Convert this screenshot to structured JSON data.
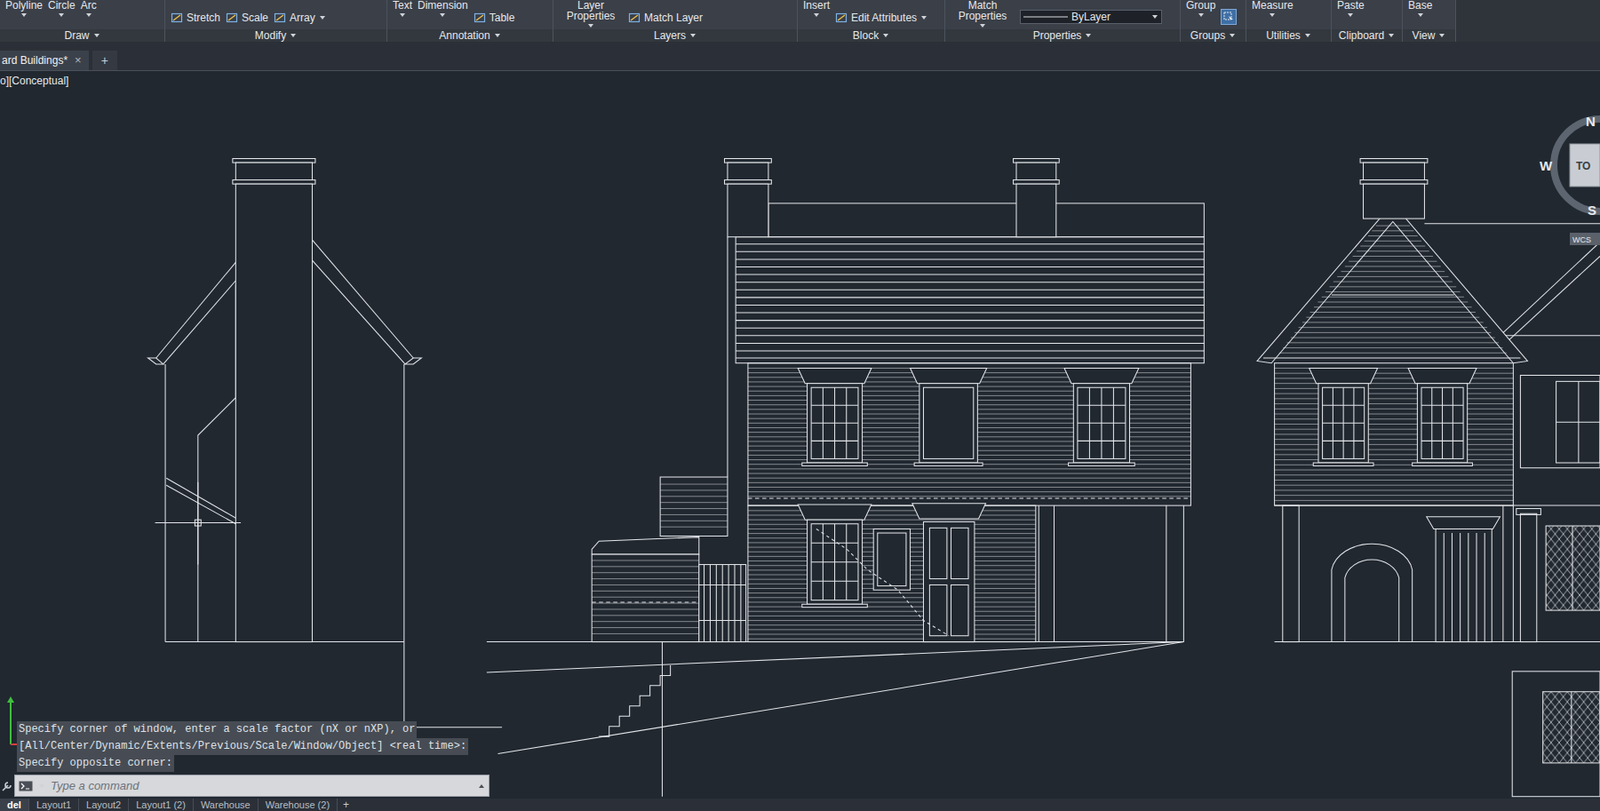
{
  "ribbon": {
    "panels": [
      {
        "label": "Draw",
        "items": [
          {
            "kind": "large",
            "label": "Polyline"
          },
          {
            "kind": "large",
            "label": "Circle"
          },
          {
            "kind": "large",
            "label": "Arc"
          }
        ]
      },
      {
        "label": "Modify",
        "items": [
          {
            "kind": "small",
            "label": "Stretch",
            "menu": false
          },
          {
            "kind": "small",
            "label": "Scale",
            "menu": false
          },
          {
            "kind": "small",
            "label": "Array",
            "menu": true
          }
        ]
      },
      {
        "label": "Annotation",
        "items": [
          {
            "kind": "large",
            "label": "Text"
          },
          {
            "kind": "large",
            "label": "Dimension"
          },
          {
            "kind": "small",
            "label": "Table",
            "menu": false
          }
        ]
      },
      {
        "label": "Layers",
        "items": [
          {
            "kind": "large",
            "label": "Layer Properties"
          },
          {
            "kind": "small",
            "label": "Match Layer",
            "menu": false
          }
        ]
      },
      {
        "label": "Block",
        "items": [
          {
            "kind": "large",
            "label": "Insert"
          },
          {
            "kind": "small",
            "label": "Edit Attributes",
            "menu": true
          }
        ]
      },
      {
        "label": "Properties",
        "items": [
          {
            "kind": "large",
            "label": "Match Properties"
          },
          {
            "kind": "dropdown",
            "label": "ByLayer"
          }
        ]
      },
      {
        "label": "Groups",
        "items": [
          {
            "kind": "large",
            "label": "Group"
          },
          {
            "kind": "toggle",
            "on": true
          }
        ]
      },
      {
        "label": "Utilities",
        "items": [
          {
            "kind": "large",
            "label": "Measure"
          }
        ]
      },
      {
        "label": "Clipboard",
        "items": [
          {
            "kind": "large",
            "label": "Paste"
          }
        ]
      },
      {
        "label": "View",
        "items": [
          {
            "kind": "large",
            "label": "Base"
          }
        ]
      }
    ]
  },
  "file_tabs": [
    {
      "label": "ard Buildings*",
      "selected": true,
      "close": "×"
    }
  ],
  "new_tab": "+",
  "viewport": {
    "label": "o][Conceptual]"
  },
  "viewcube": {
    "north": "N",
    "west": "W",
    "south": "S",
    "face": "TO",
    "ucs": "WCS"
  },
  "command_line": {
    "history": [
      "Specify corner of window, enter a scale factor (nX or nXP), or",
      "[All/Center/Dynamic/Extents/Previous/Scale/Window/Object] <real time>:",
      "Specify opposite corner:"
    ],
    "placeholder": "Type a command"
  },
  "layout_tabs": [
    {
      "label": "del",
      "selected": true
    },
    {
      "label": "Layout1",
      "selected": false
    },
    {
      "label": "Layout2",
      "selected": false
    },
    {
      "label": "Layout1 (2)",
      "selected": false
    },
    {
      "label": "Warehouse",
      "selected": false
    },
    {
      "label": "Warehouse (2)",
      "selected": false
    }
  ],
  "add_layout": "+"
}
